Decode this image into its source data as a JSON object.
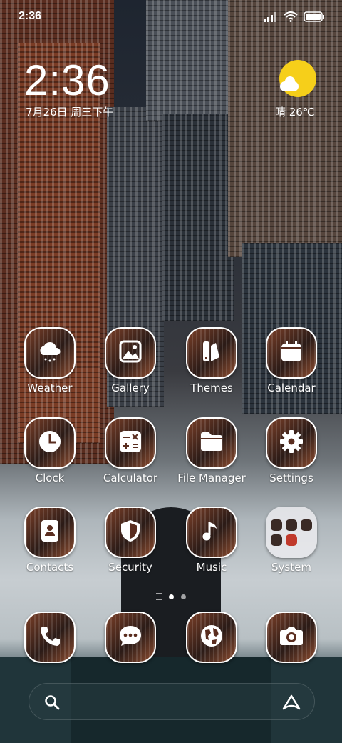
{
  "status": {
    "time": "2:36"
  },
  "clock": {
    "time": "2:36",
    "date": "7月26日 周三下午"
  },
  "weather": {
    "text": "晴 26℃"
  },
  "apps": [
    {
      "name": "Weather",
      "icon": "weather-icon"
    },
    {
      "name": "Gallery",
      "icon": "gallery-icon"
    },
    {
      "name": "Themes",
      "icon": "themes-icon"
    },
    {
      "name": "Calendar",
      "icon": "calendar-icon"
    },
    {
      "name": "Clock",
      "icon": "clock-icon"
    },
    {
      "name": "Calculator",
      "icon": "calculator-icon"
    },
    {
      "name": "File Manager",
      "icon": "folder-icon"
    },
    {
      "name": "Settings",
      "icon": "gear-icon"
    },
    {
      "name": "Contacts",
      "icon": "contacts-icon"
    },
    {
      "name": "Security",
      "icon": "shield-icon"
    },
    {
      "name": "Music",
      "icon": "music-note-icon"
    },
    {
      "name": "System",
      "icon": "folder-grid-icon"
    }
  ],
  "dock": [
    {
      "icon": "phone-icon"
    },
    {
      "icon": "message-icon"
    },
    {
      "icon": "browser-globe-icon"
    },
    {
      "icon": "camera-icon"
    }
  ],
  "pages": {
    "count": 2,
    "active": 1
  },
  "colors": {
    "sun": "#f6cf1a",
    "icon_border": "#ffffff"
  }
}
